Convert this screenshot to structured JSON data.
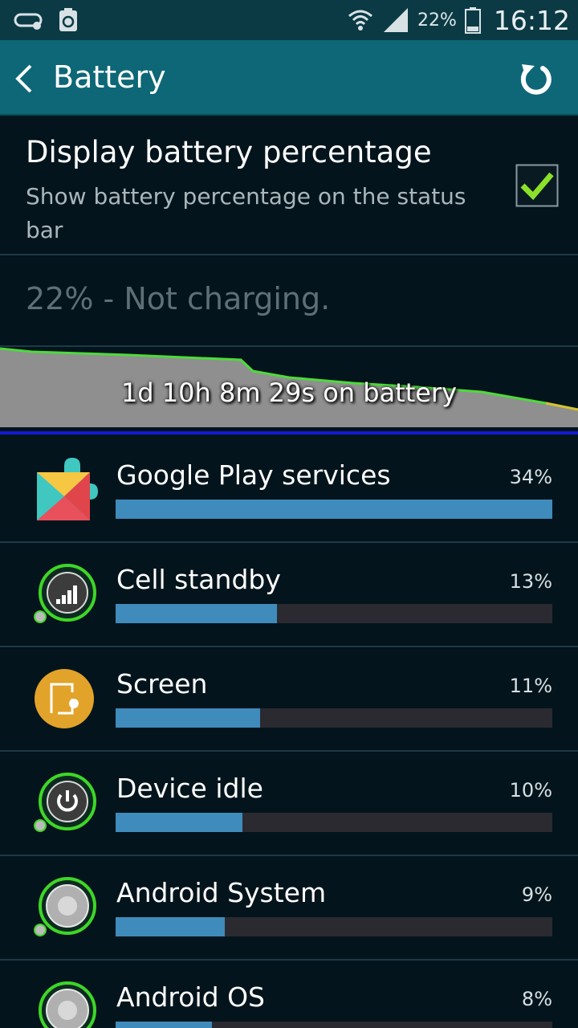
{
  "status_bar": {
    "battery_pct": "22%",
    "time": "16:12"
  },
  "header": {
    "title": "Battery"
  },
  "setting": {
    "title": "Display battery percentage",
    "subtitle": "Show battery percentage on the status bar",
    "checked": true
  },
  "battery": {
    "status": "22% - Not charging.",
    "graph_label": "1d 10h 8m 29s on battery"
  },
  "apps": [
    {
      "name": "Google Play services",
      "pct_label": "34%",
      "fraction": 1.0,
      "icon": "google-play-services-icon"
    },
    {
      "name": "Cell standby",
      "pct_label": "13%",
      "fraction": 0.37,
      "icon": "cell-signal-icon"
    },
    {
      "name": "Screen",
      "pct_label": "11%",
      "fraction": 0.33,
      "icon": "screen-brightness-icon"
    },
    {
      "name": "Device idle",
      "pct_label": "10%",
      "fraction": 0.29,
      "icon": "power-icon"
    },
    {
      "name": "Android System",
      "pct_label": "9%",
      "fraction": 0.25,
      "icon": "android-system-icon"
    },
    {
      "name": "Android OS",
      "pct_label": "8%",
      "fraction": 0.22,
      "icon": "android-os-icon"
    }
  ],
  "colors": {
    "header_bg": "#0d6776",
    "bar_fill": "#3f8bbc",
    "graph_line": "#4ddb3a",
    "checkmark": "#8be02a"
  }
}
